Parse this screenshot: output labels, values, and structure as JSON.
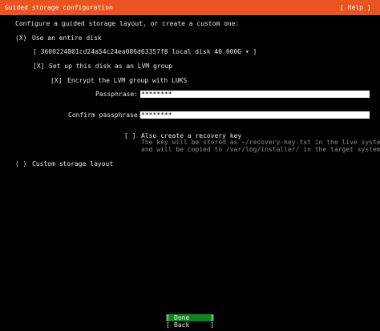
{
  "header": {
    "title": "Guided storage configuration",
    "help": "[ Help ]"
  },
  "intro": "Configure a guided storage layout, or create a custom one:",
  "use_entire_disk": {
    "marker": "(X)",
    "label": "Use an entire disk"
  },
  "disk_select": {
    "value": "[ 3600224801cd24a54c24ea086d63357f8 local disk 40.000G ▾ ]"
  },
  "lvm": {
    "marker": "[X]",
    "label": "Set up this disk as an LVM group"
  },
  "luks": {
    "marker": "[X]",
    "label": "Encrypt the LVM group with LUKS"
  },
  "passphrase": {
    "label": "Passphrase:",
    "value": "********"
  },
  "confirm_passphrase": {
    "label": "Confirm passphrase:",
    "value": "********"
  },
  "recovery": {
    "marker": "[ ]",
    "label": "Also create a recovery key",
    "help_line1": "The key will be stored as ~/recovery-key.txt in the live system",
    "help_line2": "and will be copied to /var/log/installer/ in the target system."
  },
  "custom_layout": {
    "marker": "( )",
    "label": "Custom storage layout"
  },
  "buttons": {
    "done": "Done",
    "back": "Back",
    "left_bracket": "[",
    "right_bracket": "]"
  },
  "colors": {
    "header_bg": "#e95420",
    "done_bg": "#0e8420",
    "background": "#000000"
  }
}
